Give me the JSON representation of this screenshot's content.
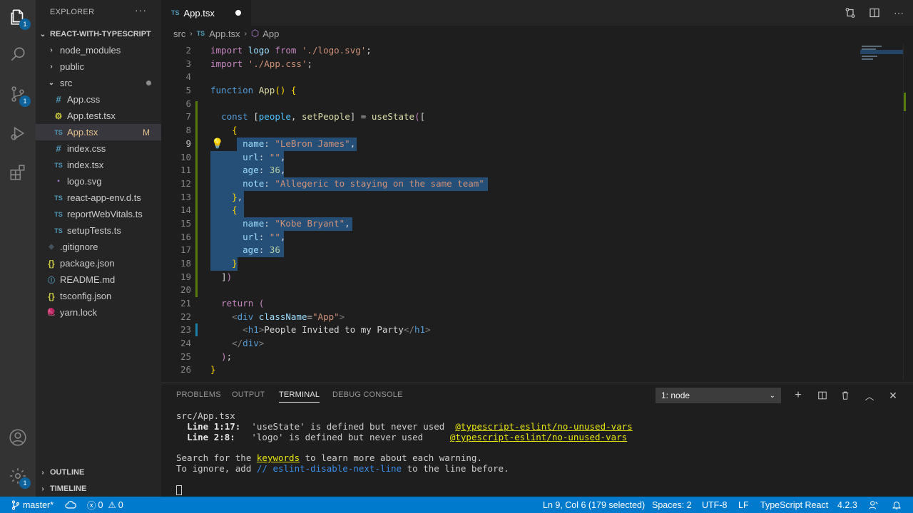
{
  "activity": {
    "explorer_badge": "1",
    "scm_badge": "1",
    "settings_badge": "1"
  },
  "sidebar": {
    "title": "EXPLORER",
    "more": "···",
    "project": "REACT-WITH-TYPESCRIPT",
    "items": [
      {
        "label": "node_modules",
        "icon": "›",
        "type": "folder"
      },
      {
        "label": "public",
        "icon": "›",
        "type": "folder"
      },
      {
        "label": "src",
        "icon": "⌄",
        "type": "folder-open"
      },
      {
        "label": "App.css",
        "icon": "#",
        "type": "css"
      },
      {
        "label": "App.test.tsx",
        "icon": "⚙",
        "type": "test"
      },
      {
        "label": "App.tsx",
        "icon": "TS",
        "type": "ts"
      },
      {
        "label": "index.css",
        "icon": "#",
        "type": "css"
      },
      {
        "label": "index.tsx",
        "icon": "TS",
        "type": "ts"
      },
      {
        "label": "logo.svg",
        "icon": "▪",
        "type": "svg"
      },
      {
        "label": "react-app-env.d.ts",
        "icon": "TS",
        "type": "ts"
      },
      {
        "label": "reportWebVitals.ts",
        "icon": "TS",
        "type": "ts"
      },
      {
        "label": "setupTests.ts",
        "icon": "TS",
        "type": "ts"
      },
      {
        "label": ".gitignore",
        "icon": "◆",
        "type": "git"
      },
      {
        "label": "package.json",
        "icon": "{}",
        "type": "json"
      },
      {
        "label": "README.md",
        "icon": "ⓘ",
        "type": "md"
      },
      {
        "label": "tsconfig.json",
        "icon": "{}",
        "type": "json"
      },
      {
        "label": "yarn.lock",
        "icon": "🧶",
        "type": "yarn"
      }
    ],
    "modified_marker": "M",
    "outline": "OUTLINE",
    "timeline": "TIMELINE"
  },
  "tab": {
    "icon": "TS",
    "label": "App.tsx"
  },
  "breadcrumb": {
    "folder": "src",
    "file_icon": "TS",
    "file": "App.tsx",
    "symbol": "App"
  },
  "code_lines": [
    "2",
    "3",
    "4",
    "5",
    "6",
    "7",
    "8",
    "9",
    "10",
    "11",
    "12",
    "13",
    "14",
    "15",
    "16",
    "17",
    "18",
    "19",
    "20",
    "21",
    "22",
    "23",
    "24",
    "25",
    "26"
  ],
  "code_text": {
    "l2": "import logo from './logo.svg';",
    "l3": "import './App.css';",
    "l5": "function App() {",
    "l7": "const [people, setPeople] = useState([",
    "l8": "{",
    "l9": "name: \"LeBron James\",",
    "l10": "url: \"\",",
    "l11": "age: 36,",
    "l12": "note: \"Allegeric to staying on the same team\"",
    "l13": "},",
    "l14": "{",
    "l15": "name: \"Kobe Bryant\",",
    "l16": "url: \"\",",
    "l17": "age: 36",
    "l18": "}",
    "l19": "])",
    "l21": "return (",
    "l22": "<div className=\"App\">",
    "l23": "<h1>People Invited to my Party</h1>",
    "l24": "</div>",
    "l25": ");",
    "l26": "}"
  },
  "panel": {
    "tabs": [
      "PROBLEMS",
      "OUTPUT",
      "TERMINAL",
      "DEBUG CONSOLE"
    ],
    "active_tab": "TERMINAL",
    "terminal_select": "1: node",
    "terminal": {
      "file": "src/App.tsx",
      "w1_loc": "Line 1:17:",
      "w1_msg": "'useState' is defined but never used",
      "w1_rule": "@typescript-eslint/no-unused-vars",
      "w2_loc": "Line 2:8:",
      "w2_msg": "'logo' is defined but never used",
      "w2_rule": "@typescript-eslint/no-unused-vars",
      "search_pre": "Search for the ",
      "search_kw": "keywords",
      "search_post": " to learn more about each warning.",
      "ignore_pre": "To ignore, add ",
      "ignore_kw": "// eslint-disable-next-line",
      "ignore_post": " to the line before."
    }
  },
  "status": {
    "branch": "master*",
    "errors": "0",
    "warnings": "0",
    "position": "Ln 9, Col 6 (179 selected)",
    "spaces": "Spaces: 2",
    "encoding": "UTF-8",
    "eol": "LF",
    "language": "TypeScript React",
    "version": "4.2.3"
  },
  "colors": {
    "accent": "#007acc",
    "selection": "#264f78",
    "sidebar_bg": "#252526",
    "editor_bg": "#1e1e1e"
  }
}
